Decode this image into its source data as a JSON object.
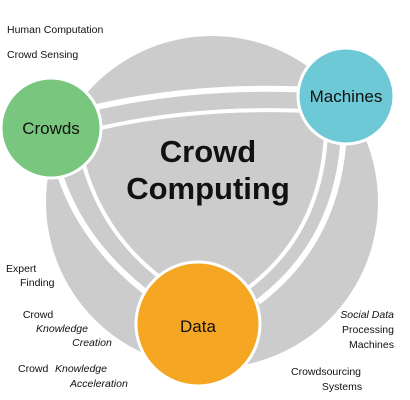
{
  "center": {
    "line1": "Crowd",
    "line2": "Computing"
  },
  "nodes": {
    "crowds": "Crowds",
    "machines": "Machines",
    "data": "Data"
  },
  "annotations": {
    "human_computation": "Human Computation",
    "crowd_sensing": "Crowd Sensing",
    "expert_finding_1": "Expert",
    "expert_finding_2": "Finding",
    "crowd_knowledge_creation_1": "Crowd",
    "crowd_knowledge_creation_2": "Knowledge",
    "crowd_knowledge_creation_3": "Creation",
    "crowd_knowledge_acceleration_1a": "Crowd",
    "crowd_knowledge_acceleration_1b": "Knowledge",
    "crowd_knowledge_acceleration_2": "Acceleration",
    "social_data_1": "Social Data",
    "social_data_2": "Processing",
    "social_data_3": "Machines",
    "crowdsourcing_1": "Crowdsourcing",
    "crowdsourcing_2": "Systems"
  },
  "colors": {
    "crowds": "#79c77e",
    "crowds_stroke": "#2f9a44",
    "machines": "#6ec9d6",
    "machines_stroke": "#1a9fb0",
    "data": "#f5a623",
    "data_stroke": "#e08a00",
    "ring": "#cccccc",
    "divider": "#ffffff"
  }
}
